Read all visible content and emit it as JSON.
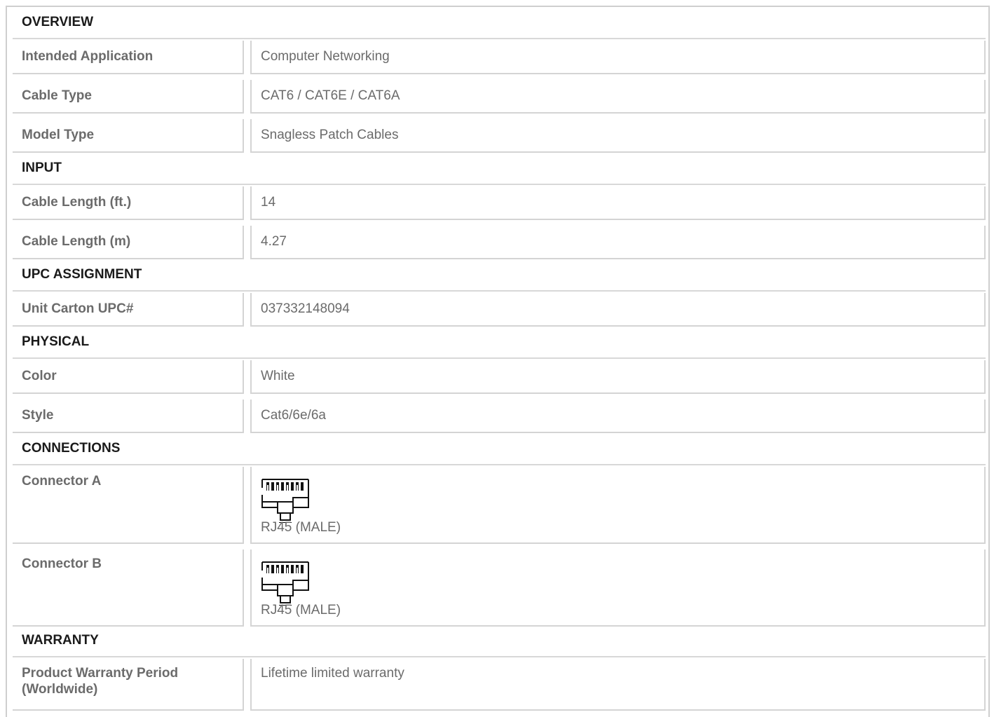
{
  "sections": {
    "overview": {
      "title": "OVERVIEW",
      "rows": [
        {
          "label": "Intended Application",
          "value": "Computer Networking"
        },
        {
          "label": "Cable Type",
          "value": "CAT6 / CAT6E / CAT6A"
        },
        {
          "label": "Model Type",
          "value": "Snagless Patch Cables"
        }
      ]
    },
    "input": {
      "title": "INPUT",
      "rows": [
        {
          "label": "Cable Length (ft.)",
          "value": "14"
        },
        {
          "label": "Cable Length (m)",
          "value": "4.27"
        }
      ]
    },
    "upc": {
      "title": "UPC ASSIGNMENT",
      "rows": [
        {
          "label": "Unit Carton UPC#",
          "value": "037332148094"
        }
      ]
    },
    "physical": {
      "title": "PHYSICAL",
      "rows": [
        {
          "label": "Color",
          "value": "White"
        },
        {
          "label": "Style",
          "value": "Cat6/6e/6a"
        }
      ]
    },
    "connections": {
      "title": "CONNECTIONS",
      "rows": [
        {
          "label": "Connector A",
          "value": "RJ45 (MALE)",
          "icon": "rj45-connector-icon"
        },
        {
          "label": "Connector B",
          "value": "RJ45 (MALE)",
          "icon": "rj45-connector-icon"
        }
      ]
    },
    "warranty": {
      "title": "WARRANTY",
      "rows": [
        {
          "label": "Product Warranty Period (Worldwide)",
          "value": "Lifetime limited warranty"
        }
      ]
    }
  }
}
